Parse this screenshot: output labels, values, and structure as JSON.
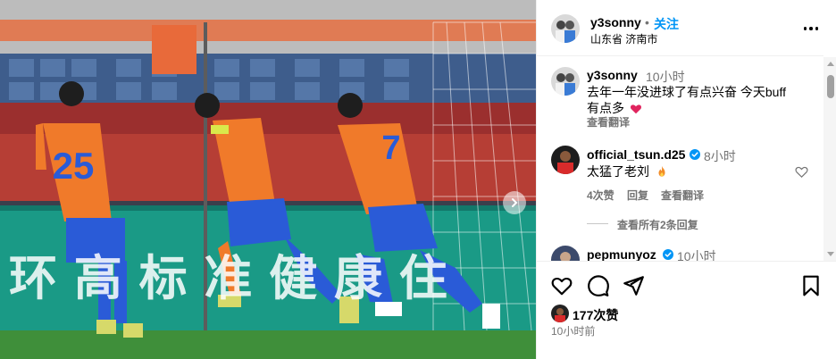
{
  "photo": {
    "banner_text": "环 高 标 准 健 康 住",
    "player_numbers": [
      "25",
      "7"
    ],
    "next_icon": "chevron-right-icon"
  },
  "header": {
    "username": "y3sonny",
    "dot": "•",
    "follow_label": "关注",
    "location": "山东省 济南市",
    "more_icon": "more-horizontal-icon"
  },
  "comments": [
    {
      "username": "y3sonny",
      "time": "10小时",
      "text_line1": "去年一年没进球了有点兴奋 今天buff",
      "text_line2": "有点多",
      "emoji": "red-heart-emoji",
      "see_translation": "查看翻译"
    },
    {
      "username": "official_tsun.d25",
      "verified": true,
      "time": "8小时",
      "text": "太猛了老刘",
      "emoji": "fire-emoji",
      "likes": "4次赞",
      "reply": "回复",
      "see_translation": "查看翻译",
      "view_replies": "查看所有2条回复"
    },
    {
      "username": "pepmunyoz",
      "verified": true,
      "time": "10小时"
    }
  ],
  "actions": {
    "like_icon": "heart-icon",
    "comment_icon": "comment-icon",
    "share_icon": "send-icon",
    "save_icon": "bookmark-icon",
    "likes_count": "177次赞",
    "post_time": "10小时前"
  },
  "colors": {
    "link_blue": "#0095f6",
    "secondary_text": "#737373",
    "verified_blue": "#0095f6",
    "heart_red": "#e0245e",
    "jersey_orange": "#f07a2a",
    "shorts_blue": "#2a5bd7",
    "pitch_green": "#3f8f3a",
    "banner_teal": "#1a9a86"
  }
}
